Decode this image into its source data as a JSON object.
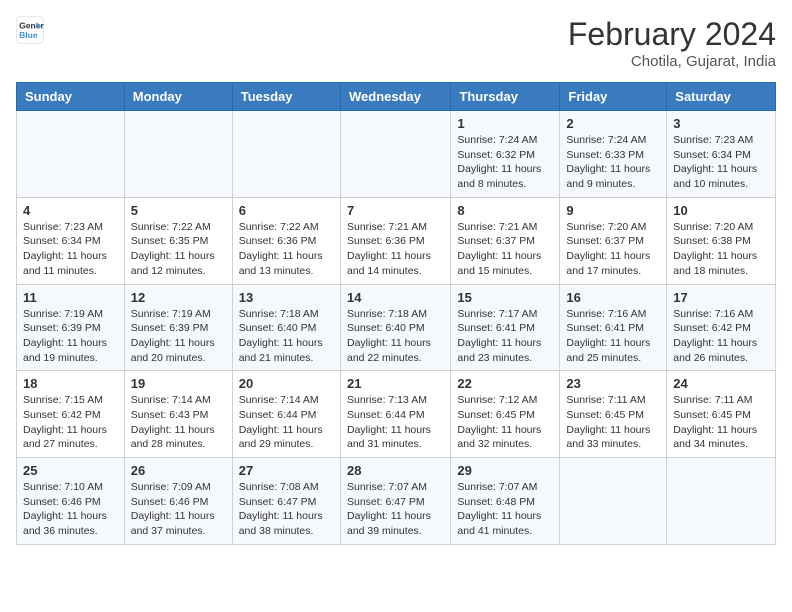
{
  "header": {
    "logo_line1": "General",
    "logo_line2": "Blue",
    "month_year": "February 2024",
    "location": "Chotila, Gujarat, India"
  },
  "days_of_week": [
    "Sunday",
    "Monday",
    "Tuesday",
    "Wednesday",
    "Thursday",
    "Friday",
    "Saturday"
  ],
  "weeks": [
    [
      {
        "day": "",
        "info": ""
      },
      {
        "day": "",
        "info": ""
      },
      {
        "day": "",
        "info": ""
      },
      {
        "day": "",
        "info": ""
      },
      {
        "day": "1",
        "info": "Sunrise: 7:24 AM\nSunset: 6:32 PM\nDaylight: 11 hours and 8 minutes."
      },
      {
        "day": "2",
        "info": "Sunrise: 7:24 AM\nSunset: 6:33 PM\nDaylight: 11 hours and 9 minutes."
      },
      {
        "day": "3",
        "info": "Sunrise: 7:23 AM\nSunset: 6:34 PM\nDaylight: 11 hours and 10 minutes."
      }
    ],
    [
      {
        "day": "4",
        "info": "Sunrise: 7:23 AM\nSunset: 6:34 PM\nDaylight: 11 hours and 11 minutes."
      },
      {
        "day": "5",
        "info": "Sunrise: 7:22 AM\nSunset: 6:35 PM\nDaylight: 11 hours and 12 minutes."
      },
      {
        "day": "6",
        "info": "Sunrise: 7:22 AM\nSunset: 6:36 PM\nDaylight: 11 hours and 13 minutes."
      },
      {
        "day": "7",
        "info": "Sunrise: 7:21 AM\nSunset: 6:36 PM\nDaylight: 11 hours and 14 minutes."
      },
      {
        "day": "8",
        "info": "Sunrise: 7:21 AM\nSunset: 6:37 PM\nDaylight: 11 hours and 15 minutes."
      },
      {
        "day": "9",
        "info": "Sunrise: 7:20 AM\nSunset: 6:37 PM\nDaylight: 11 hours and 17 minutes."
      },
      {
        "day": "10",
        "info": "Sunrise: 7:20 AM\nSunset: 6:38 PM\nDaylight: 11 hours and 18 minutes."
      }
    ],
    [
      {
        "day": "11",
        "info": "Sunrise: 7:19 AM\nSunset: 6:39 PM\nDaylight: 11 hours and 19 minutes."
      },
      {
        "day": "12",
        "info": "Sunrise: 7:19 AM\nSunset: 6:39 PM\nDaylight: 11 hours and 20 minutes."
      },
      {
        "day": "13",
        "info": "Sunrise: 7:18 AM\nSunset: 6:40 PM\nDaylight: 11 hours and 21 minutes."
      },
      {
        "day": "14",
        "info": "Sunrise: 7:18 AM\nSunset: 6:40 PM\nDaylight: 11 hours and 22 minutes."
      },
      {
        "day": "15",
        "info": "Sunrise: 7:17 AM\nSunset: 6:41 PM\nDaylight: 11 hours and 23 minutes."
      },
      {
        "day": "16",
        "info": "Sunrise: 7:16 AM\nSunset: 6:41 PM\nDaylight: 11 hours and 25 minutes."
      },
      {
        "day": "17",
        "info": "Sunrise: 7:16 AM\nSunset: 6:42 PM\nDaylight: 11 hours and 26 minutes."
      }
    ],
    [
      {
        "day": "18",
        "info": "Sunrise: 7:15 AM\nSunset: 6:42 PM\nDaylight: 11 hours and 27 minutes."
      },
      {
        "day": "19",
        "info": "Sunrise: 7:14 AM\nSunset: 6:43 PM\nDaylight: 11 hours and 28 minutes."
      },
      {
        "day": "20",
        "info": "Sunrise: 7:14 AM\nSunset: 6:44 PM\nDaylight: 11 hours and 29 minutes."
      },
      {
        "day": "21",
        "info": "Sunrise: 7:13 AM\nSunset: 6:44 PM\nDaylight: 11 hours and 31 minutes."
      },
      {
        "day": "22",
        "info": "Sunrise: 7:12 AM\nSunset: 6:45 PM\nDaylight: 11 hours and 32 minutes."
      },
      {
        "day": "23",
        "info": "Sunrise: 7:11 AM\nSunset: 6:45 PM\nDaylight: 11 hours and 33 minutes."
      },
      {
        "day": "24",
        "info": "Sunrise: 7:11 AM\nSunset: 6:45 PM\nDaylight: 11 hours and 34 minutes."
      }
    ],
    [
      {
        "day": "25",
        "info": "Sunrise: 7:10 AM\nSunset: 6:46 PM\nDaylight: 11 hours and 36 minutes."
      },
      {
        "day": "26",
        "info": "Sunrise: 7:09 AM\nSunset: 6:46 PM\nDaylight: 11 hours and 37 minutes."
      },
      {
        "day": "27",
        "info": "Sunrise: 7:08 AM\nSunset: 6:47 PM\nDaylight: 11 hours and 38 minutes."
      },
      {
        "day": "28",
        "info": "Sunrise: 7:07 AM\nSunset: 6:47 PM\nDaylight: 11 hours and 39 minutes."
      },
      {
        "day": "29",
        "info": "Sunrise: 7:07 AM\nSunset: 6:48 PM\nDaylight: 11 hours and 41 minutes."
      },
      {
        "day": "",
        "info": ""
      },
      {
        "day": "",
        "info": ""
      }
    ]
  ]
}
